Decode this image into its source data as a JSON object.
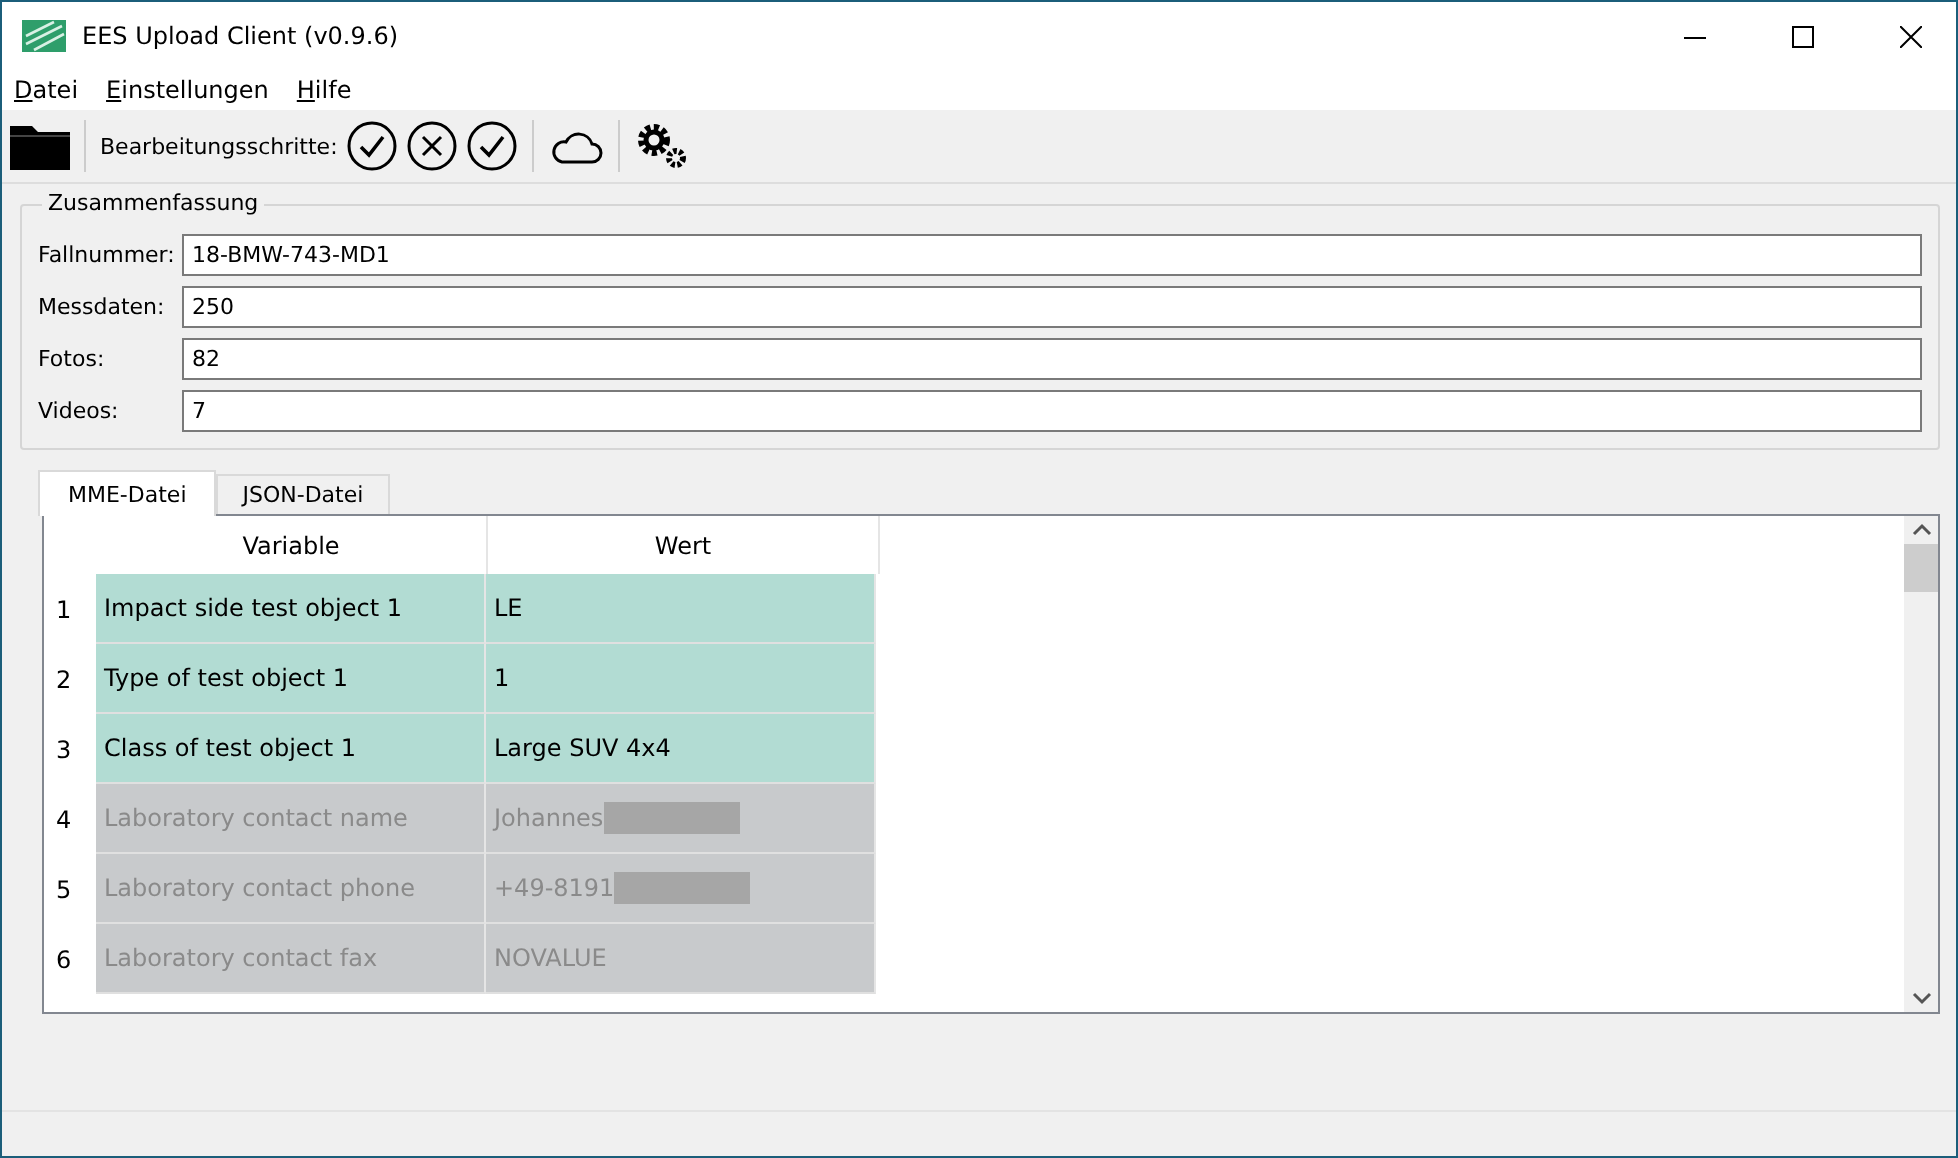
{
  "window": {
    "title": "EES Upload Client (v0.9.6)"
  },
  "menu": [
    "Datei",
    "Einstellungen",
    "Hilfe"
  ],
  "toolbar": {
    "steps_label": "Bearbeitungsschritte:",
    "steps": [
      {
        "kind": "ok"
      },
      {
        "kind": "error"
      },
      {
        "kind": "ok"
      }
    ]
  },
  "summary": {
    "title": "Zusammenfassung",
    "fields": [
      {
        "label": "Fallnummer:",
        "value": "18-BMW-743-MD1"
      },
      {
        "label": "Messdaten:",
        "value": "250"
      },
      {
        "label": "Fotos:",
        "value": "82"
      },
      {
        "label": "Videos:",
        "value": "7"
      }
    ]
  },
  "tabs": [
    {
      "label": "MME-Datei",
      "selected": true
    },
    {
      "label": "JSON-Datei",
      "selected": false
    }
  ],
  "table": {
    "columns": [
      "Variable",
      "Wert"
    ],
    "rows": [
      {
        "number": "1",
        "variable": "Impact side test object 1",
        "value": "LE",
        "disabled": false,
        "redacted": false
      },
      {
        "number": "2",
        "variable": "Type of test object 1",
        "value": "1",
        "disabled": false,
        "redacted": false
      },
      {
        "number": "3",
        "variable": "Class of test object 1",
        "value": "Large SUV 4x4",
        "disabled": false,
        "redacted": false
      },
      {
        "number": "4",
        "variable": "Laboratory contact name",
        "value": "Johannes",
        "disabled": true,
        "redacted": true
      },
      {
        "number": "5",
        "variable": "Laboratory contact phone",
        "value": "+49-8191",
        "disabled": true,
        "redacted": true
      },
      {
        "number": "6",
        "variable": "Laboratory contact fax",
        "value": "NOVALUE",
        "disabled": true,
        "redacted": false
      }
    ]
  }
}
